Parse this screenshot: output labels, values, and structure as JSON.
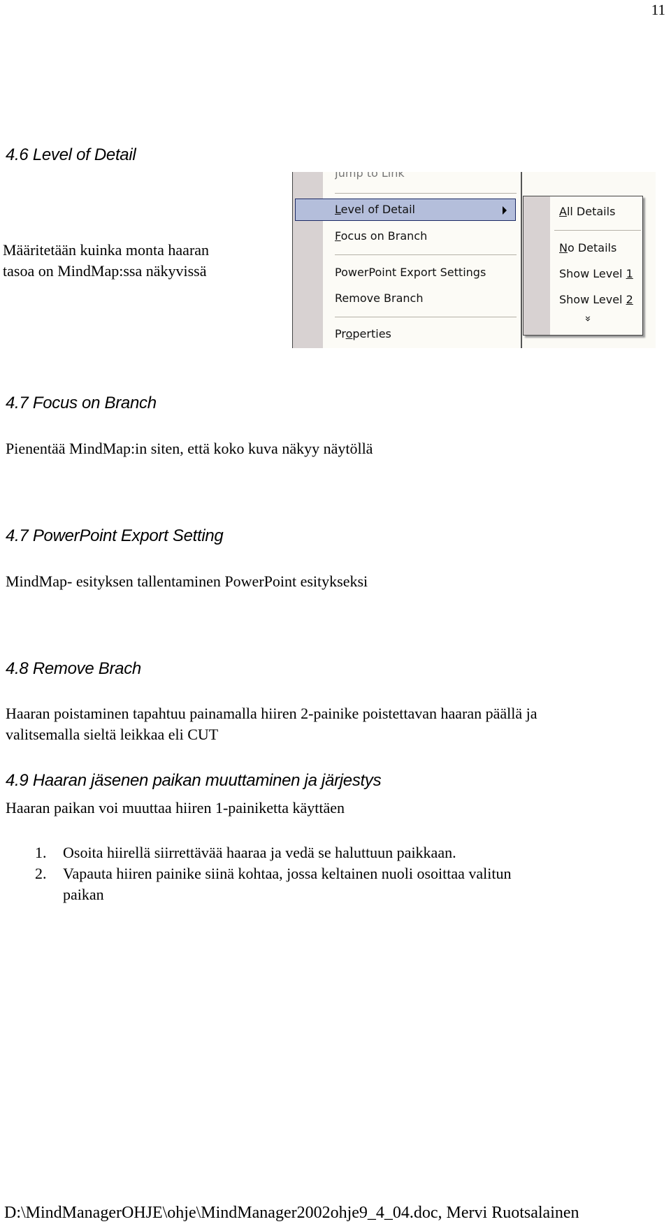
{
  "page_number": "11",
  "sections": [
    {
      "heading": "4.6 Level of Detail",
      "body": [
        "Määritetään kuinka monta haaran",
        "tasoa on MindMap:ssa näkyvissä"
      ]
    },
    {
      "heading": "4.7 Focus on Branch",
      "body": "Pienentää MindMap:in siten, että koko kuva näkyy näytöllä"
    },
    {
      "heading": "4.7 PowerPoint Export Setting",
      "body": "MindMap- esityksen tallentaminen PowerPoint esitykseksi"
    },
    {
      "heading": "4.8 Remove Brach",
      "body": [
        "Haaran poistaminen tapahtuu painamalla hiiren 2-painike poistettavan haaran päällä ja",
        "valitsemalla sieltä leikkaa eli CUT"
      ]
    },
    {
      "heading": "4.9 Haaran jäsenen paikan muuttaminen ja järjestys",
      "body": "Haaran paikan voi muuttaa hiiren 1-painiketta käyttäen"
    }
  ],
  "steps": [
    {
      "num": "1.",
      "text": "Osoita hiirellä siirrettävää haaraa ja vedä se haluttuun paikkaan."
    },
    {
      "num": "2.",
      "text": [
        "Vapauta hiiren painike siinä kohtaa, jossa keltainen nuoli osoittaa valitun",
        "paikan"
      ]
    }
  ],
  "context_menu": {
    "items": [
      {
        "first": "J",
        "rest": "ump to Link"
      },
      {
        "first": "L",
        "rest": "evel of Detail",
        "selected": true,
        "has_submenu": true
      },
      {
        "first": "F",
        "rest": "ocus on Branch"
      },
      {
        "first": "",
        "rest": "PowerPoint Export Settings"
      },
      {
        "first": "",
        "rest": "Remove Branch"
      },
      {
        "pre": "Pr",
        "first": "o",
        "rest": "perties"
      }
    ],
    "submenu": [
      {
        "first": "A",
        "rest": "ll Details"
      },
      {
        "first": "N",
        "rest": "o Details"
      },
      {
        "pre": "Show Level ",
        "first": "1",
        "rest": ""
      },
      {
        "pre": "Show Level ",
        "first": "2",
        "rest": ""
      }
    ],
    "more_icon": "»",
    "highlight_color": "#b4bedb"
  },
  "footer": "D:\\MindManagerOHJE\\ohje\\MindManager2002ohje9_4_04.doc, Mervi Ruotsalainen"
}
